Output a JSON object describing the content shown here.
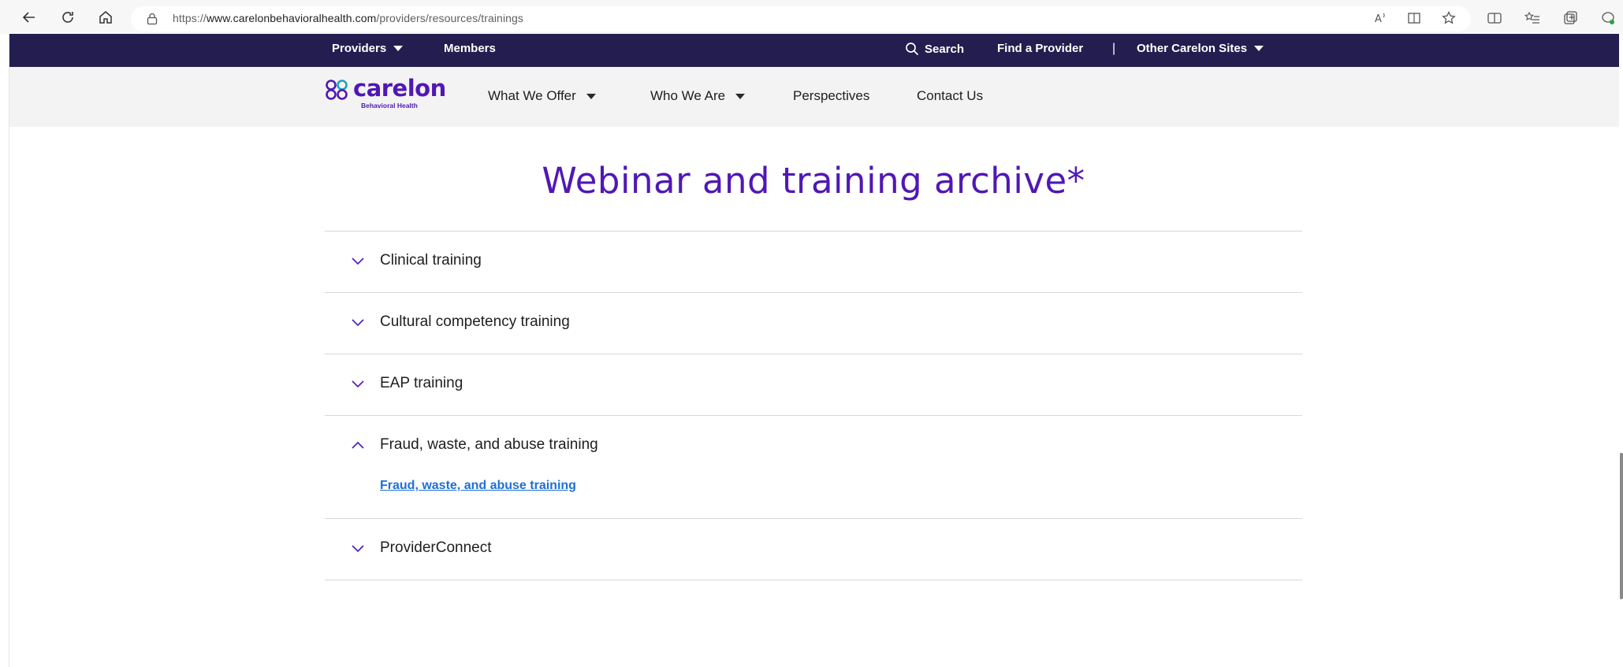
{
  "browser": {
    "url_prefix": "https://",
    "url_host": "www.carelonbehavioralhealth.com",
    "url_path": "/providers/resources/trainings"
  },
  "utility_bar": {
    "providers_label": "Providers",
    "members_label": "Members",
    "search_label": "Search",
    "find_provider_label": "Find a Provider",
    "separator": "|",
    "other_sites_label": "Other Carelon Sites"
  },
  "logo": {
    "word": "carelon",
    "sub": "Behavioral Health"
  },
  "main_nav": {
    "what_we_offer": "What We Offer",
    "who_we_are": "Who We Are",
    "perspectives": "Perspectives",
    "contact_us": "Contact Us"
  },
  "page": {
    "title": "Webinar and training archive*"
  },
  "accordion": {
    "items": [
      {
        "label": "Clinical training",
        "expanded": false
      },
      {
        "label": "Cultural competency training",
        "expanded": false
      },
      {
        "label": "EAP training",
        "expanded": false
      },
      {
        "label": "Fraud, waste, and abuse training",
        "expanded": true,
        "link": "Fraud, waste, and abuse training"
      },
      {
        "label": "ProviderConnect",
        "expanded": false
      }
    ]
  },
  "colors": {
    "brand_purple": "#5018b4",
    "utility_bg": "#231e4f",
    "nav_bg": "#f3f3f3",
    "link_blue": "#1f6fd6"
  }
}
